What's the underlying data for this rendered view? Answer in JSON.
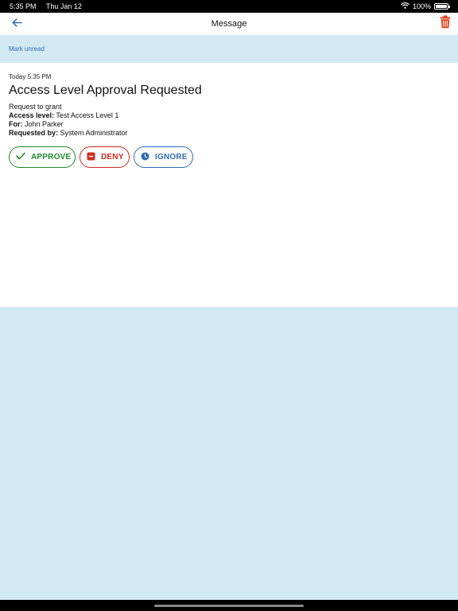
{
  "status_bar": {
    "time": "5:35 PM",
    "date": "Thu Jan 12",
    "battery": "100%",
    "battery_level": 1.0
  },
  "nav": {
    "title": "Message",
    "back_icon": "arrow-left-icon",
    "delete_icon": "trash-icon"
  },
  "actions": {
    "mark_unread": "Mark unread"
  },
  "message": {
    "timestamp": "Today 5:35 PM",
    "title": "Access Level Approval Requested",
    "intro": "Request to grant",
    "access_level_label": "Access level:",
    "access_level_value": "Test Access Level 1",
    "for_label": "For:",
    "for_value": "John Parker",
    "requested_by_label": "Requested by:",
    "requested_by_value": "System Administrator"
  },
  "buttons": {
    "approve": "APPROVE",
    "deny": "DENY",
    "ignore": "IGNORE"
  },
  "colors": {
    "approve": "#1f8a2a",
    "deny": "#d22a1f",
    "ignore": "#2f6db5",
    "accent": "#2f6db5",
    "background": "#d2e8f3",
    "trash": "#e0401a"
  }
}
